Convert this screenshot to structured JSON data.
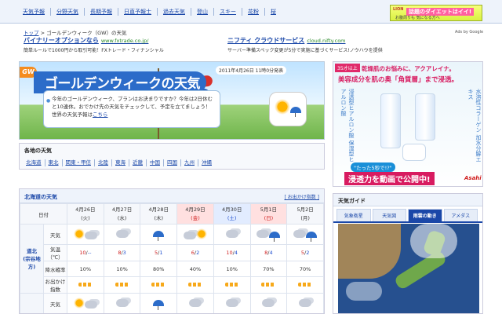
{
  "topnav": {
    "items": [
      "天気予報",
      "分野天気",
      "長期予報",
      "日直予報士",
      "過去天気",
      "登山",
      "スキー",
      "花粉",
      "桜"
    ]
  },
  "lion_ad": {
    "brand": "LION",
    "headline": "話題のダイエットはイイ!",
    "sub": "お腹周りも 気になる方へ"
  },
  "breadcrumb": {
    "home": "トップ",
    "sep": " > ",
    "current": "ゴールデンウィーク（GW）の天気"
  },
  "ads": [
    {
      "title": "バイナリーオプションなら",
      "url": "www.fxtrade.co.jp/",
      "desc": "簡単ルールで1000円から取引可能！FXトレード・フィナンシャル"
    },
    {
      "title": "ニフティ クラウドサービス",
      "url": "cloud.nifty.com",
      "desc": "サーバー準備スペック変更が5分で実施に基づくサービス!ノウハウを提供"
    }
  ],
  "ads_by": "Ads by Google",
  "gw_banner": {
    "badge": "GW",
    "title": "ゴールデンウィークの天気",
    "date": "2011年4月26日 11時0分発表",
    "text": "今年のゴールデンウィーク、プランはお決まりですか？今年は2日休むと10連休。おでかけ先の天気をチェックして、予定を立てましょう！世界の天気予報は",
    "link": "こちら"
  },
  "regions": {
    "heading": "各地の天気",
    "items": [
      "北海道",
      "東北",
      "関東・甲信",
      "北陸",
      "東海",
      "近畿",
      "中国",
      "四国",
      "九州",
      "沖縄"
    ]
  },
  "forecast": {
    "title": "北海道の天気",
    "outing_link": "[ お出かけ指数 ]",
    "corner": "日付",
    "days": [
      {
        "date": "4月26日",
        "dow": "(火)",
        "type": "weekday"
      },
      {
        "date": "4月27日",
        "dow": "(水)",
        "type": "weekday"
      },
      {
        "date": "4月28日",
        "dow": "(木)",
        "type": "weekday"
      },
      {
        "date": "4月29日",
        "dow": "(金)",
        "type": "holiday"
      },
      {
        "date": "4月30日",
        "dow": "(土)",
        "type": "saturday"
      },
      {
        "date": "5月1日",
        "dow": "(日)",
        "type": "holiday"
      },
      {
        "date": "5月2日",
        "dow": "(月)",
        "type": "weekday"
      }
    ],
    "row_labels": {
      "weather": "天気",
      "temp": "気温（℃）",
      "rain": "降水確率",
      "outing": "お出かけ指数"
    },
    "areas": [
      {
        "name1": "道北",
        "name2": "(宗谷地方)",
        "weather": [
          "sunny-cloudy",
          "cloudy",
          "rain",
          "cloudy-sunny",
          "cloudy",
          "cloudy-rain",
          "cloudy-rain"
        ],
        "max": [
          "10",
          "8",
          "5",
          "6",
          "10",
          "8",
          "5"
        ],
        "min": [
          "--",
          "3",
          "1",
          "2",
          "4",
          "4",
          "2"
        ],
        "rain": [
          "10%",
          "10%",
          "80%",
          "40%",
          "10%",
          "70%",
          "70%"
        ]
      },
      {
        "weather": [
          "sunny-cloudy",
          "cloudy",
          "rain",
          "cloudy",
          "cloudy",
          "cloudy",
          "cloudy"
        ]
      }
    ]
  },
  "right_ad": {
    "age_badge": "35才以上",
    "headline": "乾燥肌のお悩みに、アクアレイナ。",
    "sub": "美容成分を肌の奥「角質層」まで浸透。",
    "left_vertical": "浸透型ヒアルロン酸 保湿型ヒアルロン酸",
    "right_vertical": "水溶性コラーゲン 加水分解エキス",
    "cta_small": "\"たった5秒で!?\"",
    "cta_big": "浸透力を動画で公開中!",
    "brand": "Asahi"
  },
  "weather_guide": {
    "heading": "天気ガイド",
    "tabs": [
      "気象衛星",
      "天気図",
      "雨雲の動き",
      "アメダス"
    ],
    "active_tab": 2
  },
  "colors": {
    "link": "#1a47a8",
    "brand_blue": "#2c6cc9",
    "holiday_red": "#d02020",
    "saturday_blue": "#2050d0"
  }
}
